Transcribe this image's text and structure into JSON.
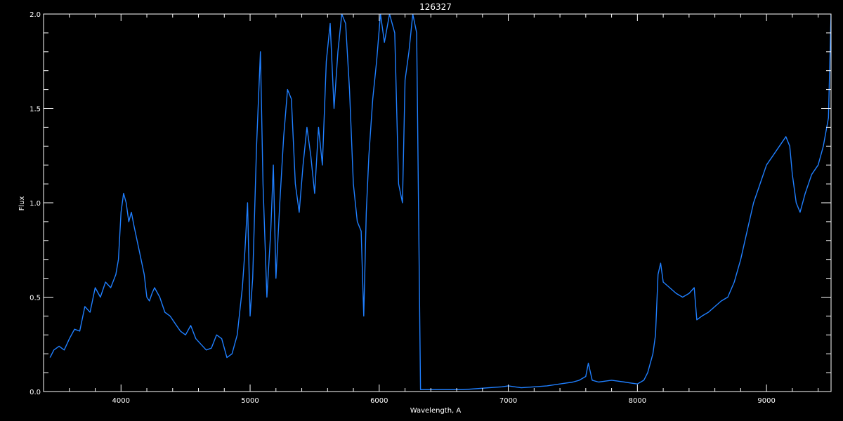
{
  "chart_data": {
    "type": "line",
    "title": "126327",
    "xlabel": "Wavelength, A",
    "ylabel": "Flux",
    "xlim": [
      3400,
      9500
    ],
    "ylim": [
      0.0,
      2.0
    ],
    "x_ticks": [
      4000,
      5000,
      6000,
      7000,
      8000,
      9000
    ],
    "y_ticks": [
      0.0,
      0.5,
      1.0,
      1.5,
      2.0
    ],
    "x_tick_labels": [
      "4000",
      "5000",
      "6000",
      "7000",
      "8000",
      "9000"
    ],
    "y_tick_labels": [
      "0.0",
      "0.5",
      "1.0",
      "1.5",
      "2.0"
    ],
    "grid": false,
    "colors": {
      "background": "#000000",
      "axes": "#ffffff",
      "line": "#1f7fff"
    },
    "series": [
      {
        "x": [
          3450,
          3480,
          3520,
          3560,
          3600,
          3640,
          3680,
          3720,
          3760,
          3800,
          3840,
          3880,
          3920,
          3960,
          3980,
          4000,
          4020,
          4040,
          4060,
          4080,
          4100,
          4140,
          4180,
          4200,
          4220,
          4240,
          4260,
          4300,
          4340,
          4380,
          4420,
          4460,
          4500,
          4540,
          4580,
          4620,
          4660,
          4700,
          4740,
          4780,
          4820,
          4860,
          4900,
          4940,
          4960,
          4980,
          5000,
          5020,
          5050,
          5080,
          5100,
          5130,
          5160,
          5180,
          5200,
          5230,
          5260,
          5290,
          5320,
          5350,
          5380,
          5410,
          5440,
          5470,
          5500,
          5530,
          5560,
          5590,
          5620,
          5650,
          5680,
          5710,
          5740,
          5770,
          5800,
          5830,
          5860,
          5880,
          5900,
          5920,
          5950,
          5980,
          6010,
          6040,
          6080,
          6120,
          6150,
          6180,
          6200,
          6230,
          6260,
          6290,
          6320,
          6380,
          6450,
          6550,
          6650,
          6750,
          6850,
          6950,
          7000,
          7050,
          7100,
          7200,
          7300,
          7400,
          7500,
          7550,
          7600,
          7620,
          7650,
          7700,
          7750,
          7800,
          7850,
          7900,
          7950,
          8000,
          8050,
          8080,
          8100,
          8120,
          8140,
          8160,
          8180,
          8200,
          8250,
          8300,
          8350,
          8400,
          8440,
          8460,
          8500,
          8550,
          8600,
          8650,
          8700,
          8750,
          8800,
          8850,
          8900,
          8950,
          9000,
          9050,
          9100,
          9150,
          9180,
          9200,
          9230,
          9260,
          9300,
          9350,
          9400,
          9440,
          9480,
          9500
        ],
        "y": [
          0.18,
          0.22,
          0.24,
          0.22,
          0.28,
          0.33,
          0.32,
          0.45,
          0.42,
          0.55,
          0.5,
          0.58,
          0.55,
          0.62,
          0.7,
          0.95,
          1.05,
          1.0,
          0.9,
          0.95,
          0.88,
          0.75,
          0.62,
          0.5,
          0.48,
          0.52,
          0.55,
          0.5,
          0.42,
          0.4,
          0.36,
          0.32,
          0.3,
          0.35,
          0.28,
          0.25,
          0.22,
          0.23,
          0.3,
          0.28,
          0.18,
          0.2,
          0.3,
          0.55,
          0.75,
          1.0,
          0.4,
          0.6,
          1.3,
          1.8,
          1.1,
          0.5,
          0.85,
          1.2,
          0.6,
          1.0,
          1.35,
          1.6,
          1.55,
          1.1,
          0.95,
          1.2,
          1.4,
          1.25,
          1.05,
          1.4,
          1.2,
          1.75,
          1.95,
          1.5,
          1.8,
          2.0,
          1.95,
          1.6,
          1.1,
          0.9,
          0.85,
          0.4,
          0.95,
          1.25,
          1.55,
          1.75,
          2.0,
          1.85,
          2.0,
          1.9,
          1.1,
          1.0,
          1.65,
          1.8,
          2.0,
          1.9,
          0.01,
          0.01,
          0.01,
          0.01,
          0.01,
          0.015,
          0.02,
          0.025,
          0.03,
          0.025,
          0.02,
          0.025,
          0.03,
          0.04,
          0.05,
          0.06,
          0.08,
          0.15,
          0.06,
          0.05,
          0.055,
          0.06,
          0.055,
          0.05,
          0.045,
          0.04,
          0.06,
          0.1,
          0.15,
          0.2,
          0.3,
          0.62,
          0.68,
          0.58,
          0.55,
          0.52,
          0.5,
          0.52,
          0.55,
          0.38,
          0.4,
          0.42,
          0.45,
          0.48,
          0.5,
          0.58,
          0.7,
          0.85,
          1.0,
          1.1,
          1.2,
          1.25,
          1.3,
          1.35,
          1.3,
          1.15,
          1.0,
          0.95,
          1.05,
          1.15,
          1.2,
          1.3,
          1.45,
          2.0
        ]
      }
    ]
  }
}
